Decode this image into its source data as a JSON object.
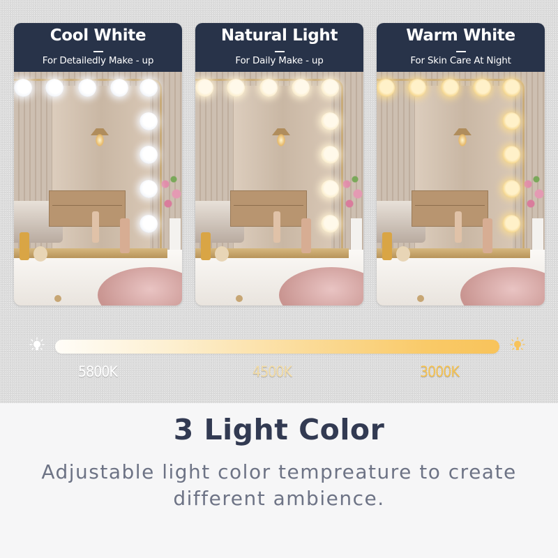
{
  "cards": [
    {
      "title": "Cool White",
      "subtitle": "For Detailedly Make - up",
      "bulb_color": "#ffffff",
      "glow_color": "#f4f6fa"
    },
    {
      "title": "Natural Light",
      "subtitle": "For Daily Make - up",
      "bulb_color": "#fff9ea",
      "glow_color": "#fbeed0"
    },
    {
      "title": "Warm White",
      "subtitle": "For Skin Care At Night",
      "bulb_color": "#fff1c9",
      "glow_color": "#f6d995"
    }
  ],
  "slider": {
    "start_icon": "cool-bulb-icon",
    "end_icon": "warm-sun-icon",
    "labels": [
      {
        "text": "5800K",
        "color": "#ffffff"
      },
      {
        "text": "4500K",
        "color": "#f3dca6"
      },
      {
        "text": "3000K",
        "color": "#f6c250"
      }
    ]
  },
  "headline": "3 Light Color",
  "description": "Adjustable light color tempreature to create different ambience.",
  "colors": {
    "header_bg": "#283349",
    "title_text": "#323a52",
    "desc_text": "#6d7385"
  }
}
